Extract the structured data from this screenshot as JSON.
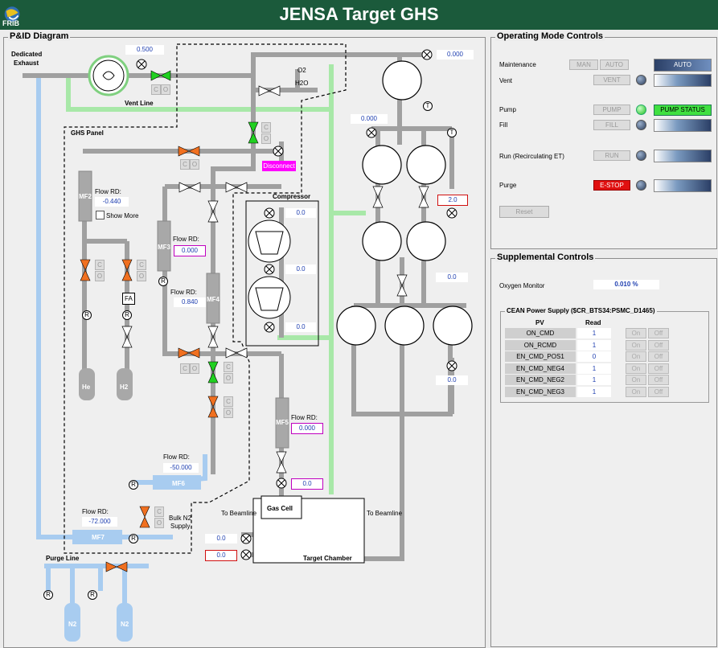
{
  "app": {
    "title": "JENSA Target GHS",
    "logo_text": "FRIB"
  },
  "pid": {
    "title": "P&ID Diagram",
    "dedicated_exhaust": [
      "Dedicated",
      "Exhaust"
    ],
    "vent_line": "Vent Line",
    "vent_value": "0.500",
    "top_right_value": "0.000",
    "o2": "O2",
    "h2o": "H2O",
    "ghs_panel": "GHS Panel",
    "disconnect": "Disconnect",
    "compressor": "Compressor",
    "compressor_values": [
      "0.0",
      "0.0",
      "0.0"
    ],
    "mf2": {
      "label": "MF2",
      "flow_label": "Flow RD:",
      "value": "-0.440",
      "show_more": "Show More"
    },
    "mf3": {
      "label": "MF3",
      "flow_label": "Flow RD:",
      "value": "0.000"
    },
    "mf4": {
      "label": "MF4",
      "flow_label": "Flow RD:",
      "value": "0.840"
    },
    "mf5": {
      "label": "MF5",
      "flow_label": "Flow RD:",
      "value": "0.000",
      "lower_value": "0.0"
    },
    "mf6": {
      "label": "MF6",
      "flow_label": "Flow RD:",
      "value": "-50.000"
    },
    "mf7": {
      "label": "MF7",
      "flow_label": "Flow RD:",
      "value": "-72.000"
    },
    "bulk_n2": [
      "Bulk N2",
      "Supply"
    ],
    "fa": "FA",
    "gas_he": "He",
    "gas_h2": "H2",
    "gas_n2": "N2",
    "purge_line": "Purge Line",
    "gas_cell": "Gas Cell",
    "to_beamline": "To Beamline",
    "target_chamber": "Target Chamber",
    "tc_values": [
      "0.0",
      "0.0"
    ],
    "pump_values": {
      "left_top": "0.000",
      "red": "2.0",
      "mid": "0.0",
      "bottom": "0.0"
    },
    "regulator": "R",
    "small_c": "C",
    "small_o": "O",
    "t_label": "T"
  },
  "operating": {
    "title": "Operating Mode Controls",
    "maintenance": "Maintenance",
    "man": "MAN",
    "auto": "AUTO",
    "auto_status": "AUTO",
    "vent": "Vent",
    "vent_btn": "VENT",
    "pump": "Pump",
    "pump_btn": "PUMP",
    "pump_status": "PUMP STATUS",
    "fill": "Fill",
    "fill_btn": "FILL",
    "run": "Run (Recirculating ET)",
    "run_btn": "RUN",
    "purge": "Purge",
    "estop": "E-STOP",
    "reset": "Reset"
  },
  "supplemental": {
    "title": "Supplemental Controls",
    "oxygen_label": "Oxygen Monitor",
    "oxygen_value": "0.010 %",
    "cean_title": "CEAN Power Supply ($CR_BTS34:PSMC_D1465)",
    "pv_header": "PV",
    "read_header": "Read",
    "on": "On",
    "off": "Off",
    "rows": [
      {
        "pv": "ON_CMD",
        "read": "1"
      },
      {
        "pv": "ON_RCMD",
        "read": "1"
      },
      {
        "pv": "EN_CMD_POS1",
        "read": "0"
      },
      {
        "pv": "EN_CMD_NEG4",
        "read": "1"
      },
      {
        "pv": "EN_CMD_NEG2",
        "read": "1"
      },
      {
        "pv": "EN_CMD_NEG3",
        "read": "1"
      }
    ]
  },
  "colors": {
    "title_bg": "#1b5a3b",
    "pipe_gray": "#a0a0a0",
    "pipe_blue": "#a8ccf0",
    "pipe_green": "#a8e8a8",
    "valve_orange": "#f07020",
    "valve_green": "#20d020"
  }
}
